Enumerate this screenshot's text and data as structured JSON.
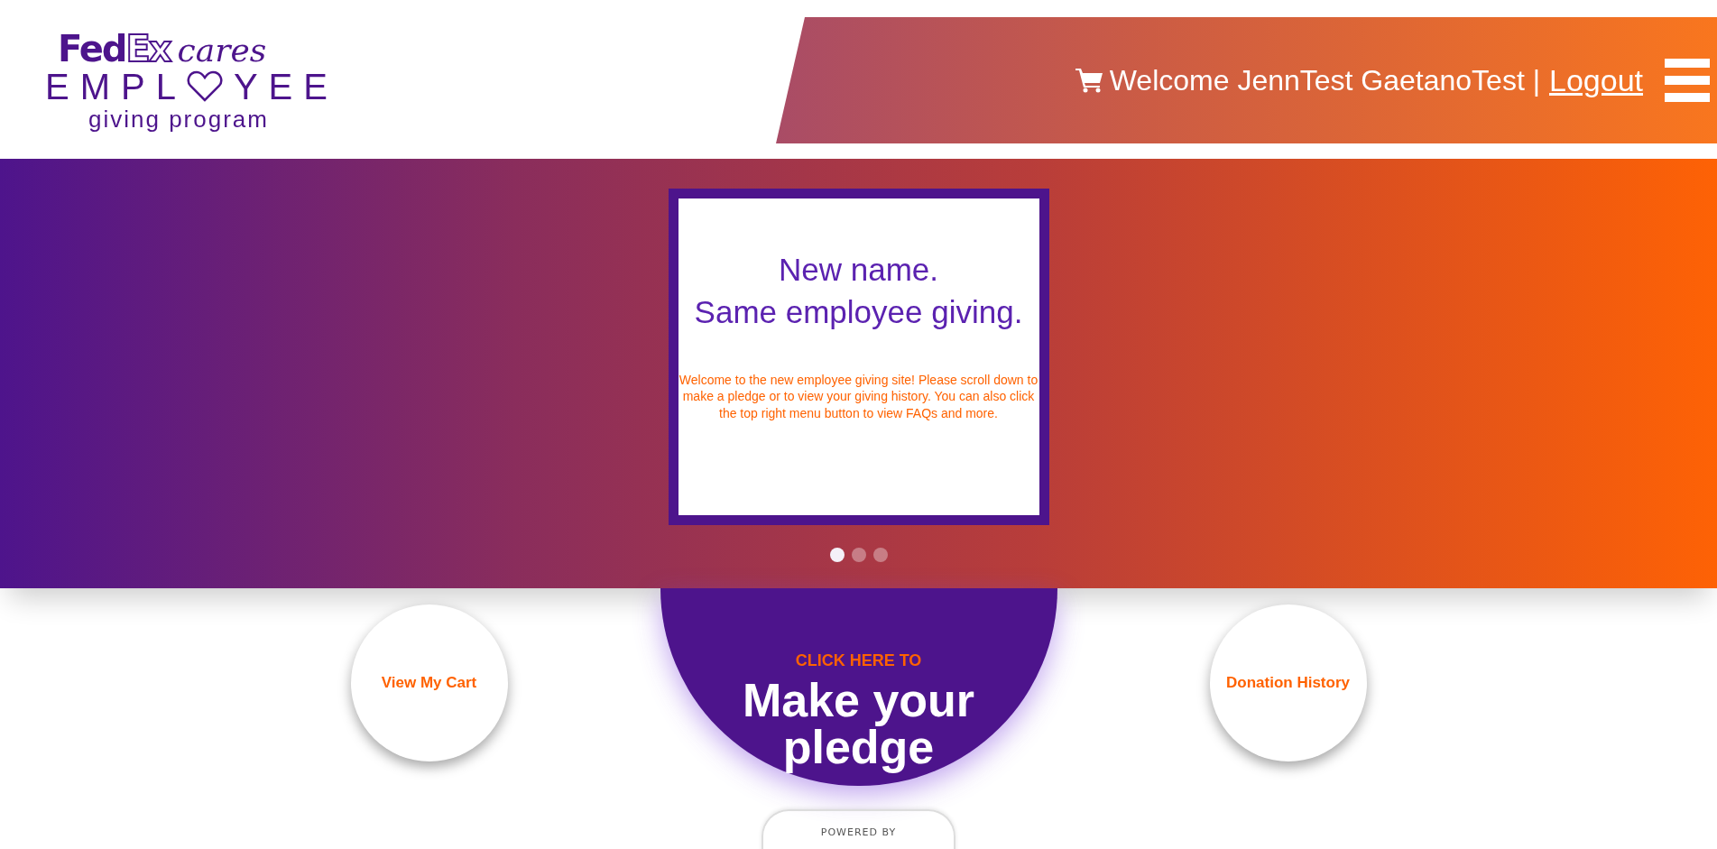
{
  "logo": {
    "brand_solid": "Fed",
    "brand_outline": "Ex",
    "tagline": "cares",
    "word_start": "EMPL",
    "word_end": "YEE",
    "subtitle": "giving program"
  },
  "header": {
    "welcome": "Welcome JennTest GaetanoTest |",
    "logout": "Logout"
  },
  "slide": {
    "title_lines": [
      "New name.",
      "Same employee giving."
    ],
    "body": "Welcome to the new employee giving site! Please scroll down to make a pledge or to view your giving history. You can also click the top right menu button to view FAQs and more."
  },
  "indicators": [
    {
      "selected": true
    },
    {
      "selected": false
    },
    {
      "selected": false
    }
  ],
  "actions": [
    {
      "kind": "side",
      "label": "View My Cart"
    },
    {
      "kind": "main",
      "kicker": "CLICK HERE TO",
      "label": "Make your pledge"
    },
    {
      "kind": "side",
      "label": "Donation History"
    }
  ],
  "footer": {
    "powered_by": "POWERED BY"
  }
}
